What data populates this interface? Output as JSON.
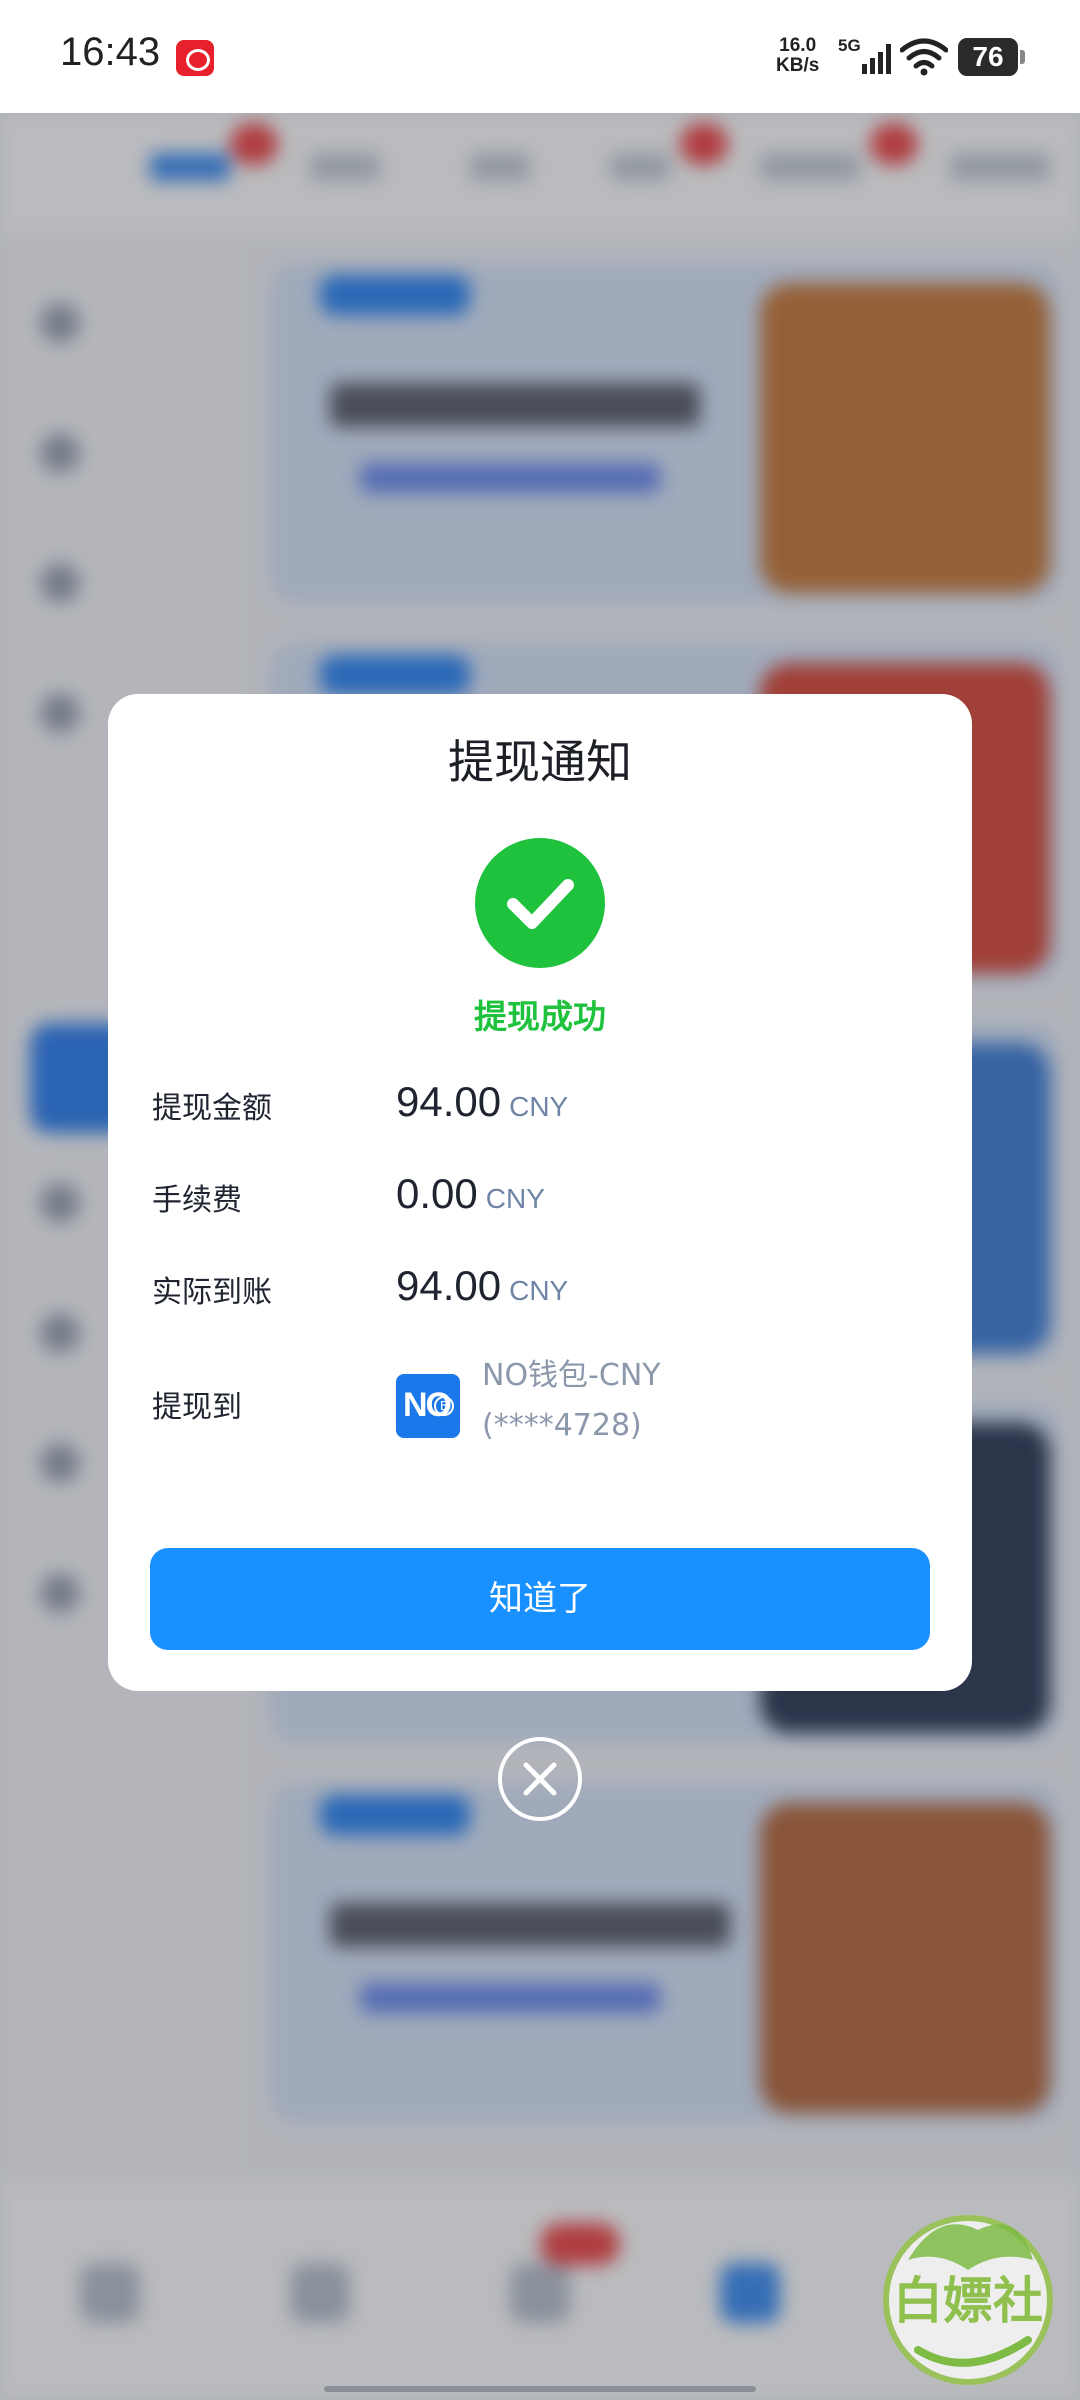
{
  "status_bar": {
    "time": "16:43",
    "net_speed_value": "16.0",
    "net_speed_unit": "KB/s",
    "network_type": "5G",
    "battery": "76"
  },
  "dialog": {
    "title": "提现通知",
    "status_icon": "check-circle-icon",
    "status_text": "提现成功",
    "rows": [
      {
        "label": "提现金额",
        "value": "94.00",
        "unit": "CNY"
      },
      {
        "label": "手续费",
        "value": "0.00",
        "unit": "CNY"
      },
      {
        "label": "实际到账",
        "value": "94.00",
        "unit": "CNY"
      }
    ],
    "destination": {
      "label": "提现到",
      "icon_text": "NO",
      "icon_badge": "B",
      "wallet_name": "NO钱包-CNY",
      "account": "(****4728)"
    },
    "confirm_label": "知道了"
  },
  "watermark_text": "白嫖社",
  "colors": {
    "primary": "#1890ff",
    "success": "#1fc23c",
    "muted_text": "#8b97aa"
  }
}
